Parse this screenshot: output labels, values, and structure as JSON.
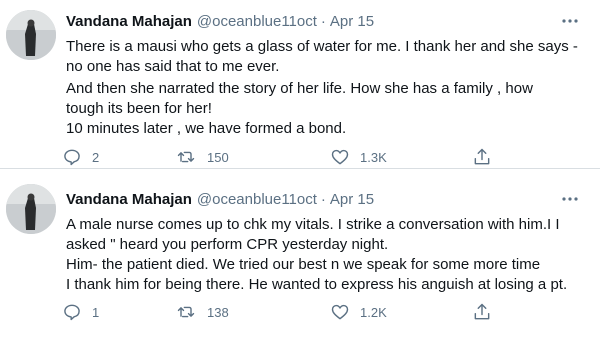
{
  "tweets": [
    {
      "name": "Vandana Mahajan",
      "handle": "@oceanblue11oct",
      "separator": "·",
      "date": "Apr 15",
      "lines": [
        "There is a mausi who gets a glass of water for me. I thank her and she says -",
        "no one has said that to me ever.",
        "And then she narrated the story of her life. How she has a family , how",
        "tough its been for her!",
        "10 minutes later , we have formed a bond."
      ],
      "replies": "2",
      "retweets": "150",
      "likes": "1.3K"
    },
    {
      "name": "Vandana Mahajan",
      "handle": "@oceanblue11oct",
      "separator": "·",
      "date": "Apr 15",
      "lines": [
        "A male nurse comes up to chk my vitals. I strike a conversation with him.I  I",
        "asked \" heard you perform CPR yesterday night.",
        "Him- the patient died. We tried our best n we speak for some more time",
        "I thank him for being there. He wanted to express his anguish at losing a pt."
      ],
      "replies": "1",
      "retweets": "138",
      "likes": "1.2K"
    }
  ],
  "icons": {
    "more": "more-horizontal-icon",
    "reply": "reply-icon",
    "retweet": "retweet-icon",
    "like": "like-icon",
    "share": "share-icon"
  },
  "colors": {
    "text": "#0f1419",
    "muted": "#5b7083",
    "divider": "#d9dee2"
  }
}
